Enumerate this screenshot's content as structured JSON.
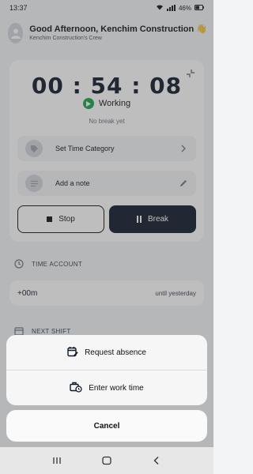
{
  "status_bar": {
    "time": "13:37",
    "battery": "46%"
  },
  "header": {
    "greeting": "Good Afternoon, Kenchim Construction 👋",
    "subtitle": "Kenchim Construction's Crew"
  },
  "timer": {
    "value": "00 : 54 : 08",
    "status": "Working",
    "break_info": "No break yet"
  },
  "fields": {
    "time_category": "Set Time Category",
    "note": "Add a note"
  },
  "buttons": {
    "stop": "Stop",
    "break": "Break"
  },
  "time_account": {
    "label": "TIME ACCOUNT",
    "value": "+00m",
    "note": "until yesterday"
  },
  "next_shift": {
    "label": "NEXT SHIFT"
  },
  "action_sheet": {
    "items": [
      {
        "label": "Request absence",
        "icon": "calendar-edit-icon"
      },
      {
        "label": "Enter work time",
        "icon": "briefcase-clock-icon"
      }
    ],
    "cancel": "Cancel"
  },
  "colors": {
    "accent": "#0f172a",
    "working": "#16a34a"
  }
}
